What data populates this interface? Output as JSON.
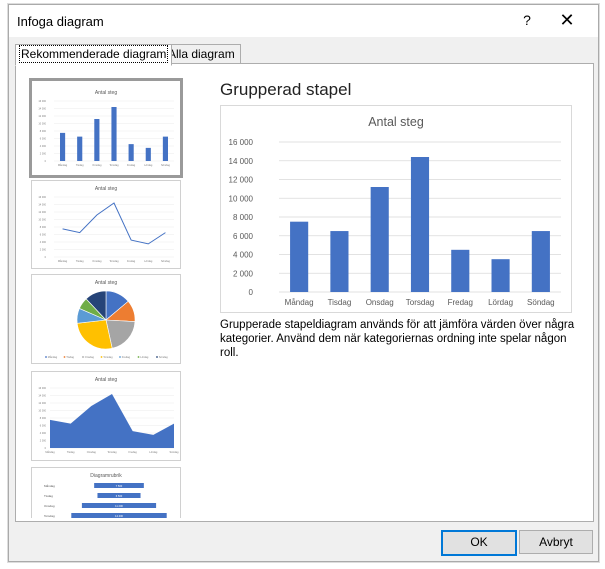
{
  "dialog": {
    "title": "Infoga diagram",
    "help_glyph": "?",
    "close_glyph": "✕"
  },
  "tabs": [
    {
      "label": "Rekommenderade diagram",
      "active": true
    },
    {
      "label": "Alla diagram",
      "active": false
    }
  ],
  "preview": {
    "heading": "Grupperad stapel",
    "description": "Grupperade stapeldiagram används för att jämföra värden över några kategorier. Använd dem när kategoriernas ordning inte spelar någon roll."
  },
  "thumbnails": [
    {
      "type": "bar",
      "title": "Antal steg",
      "selected": true
    },
    {
      "type": "line",
      "title": "Antal steg",
      "selected": false
    },
    {
      "type": "pie",
      "title": "Antal steg",
      "selected": false
    },
    {
      "type": "area",
      "title": "Antal steg",
      "selected": false
    },
    {
      "type": "bar-horizontal",
      "title": "Diagramrubrik",
      "selected": false
    }
  ],
  "buttons": {
    "ok": "OK",
    "cancel": "Avbryt"
  },
  "colors": {
    "accent": "#4472c4",
    "pie": [
      "#4472c4",
      "#ed7d31",
      "#a5a5a5",
      "#ffc000",
      "#5b9bd5",
      "#70ad47",
      "#264478"
    ]
  },
  "chart_data": {
    "type": "bar",
    "title": "Antal steg",
    "categories": [
      "Måndag",
      "Tisdag",
      "Onsdag",
      "Torsdag",
      "Fredag",
      "Lördag",
      "Söndag"
    ],
    "values": [
      7500,
      6500,
      11200,
      14400,
      4500,
      3500,
      6500
    ],
    "yticks": [
      "0",
      "2 000",
      "4 000",
      "6 000",
      "8 000",
      "10 000",
      "12 000",
      "14 000",
      "16 000"
    ],
    "ylim": [
      0,
      16000
    ],
    "grid": true
  }
}
